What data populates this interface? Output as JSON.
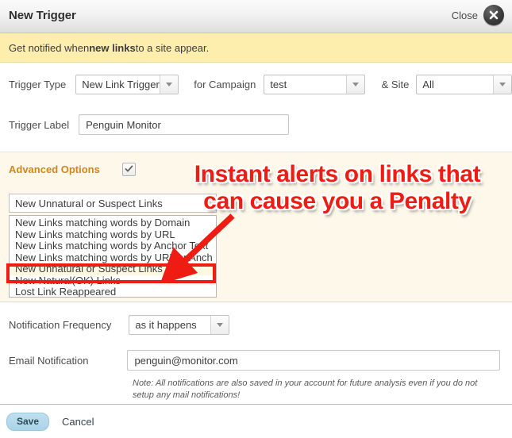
{
  "dialog": {
    "title": "New Trigger",
    "close_label": "Close",
    "close_icon": "close-circle-icon"
  },
  "notice": {
    "prefix": "Get notified when ",
    "emphasis": "new links",
    "suffix": " to a site appear."
  },
  "form": {
    "trigger_type_label": "Trigger Type",
    "trigger_type_value": "New Link Trigger",
    "for_campaign_label": "for Campaign",
    "campaign_value": "test",
    "site_label": "& Site",
    "site_value": "All",
    "trigger_label_label": "Trigger Label",
    "trigger_label_value": "Penguin Monitor",
    "trigger_label_placeholder": "Trigger Label"
  },
  "advanced": {
    "title": "Advanced Options",
    "checkbox_checked": true,
    "selected_value": "New Unnatural or Suspect Links",
    "options": [
      "New Links matching words by Domain",
      "New Links matching words by URL",
      "New Links matching words by Anchor Text",
      "New Links matching words by URL or Anch",
      "New Unnatural or Suspect Links",
      "New Natural(OK) Links",
      "Lost Link Reappeared"
    ],
    "selected_index": 4
  },
  "annotation": {
    "line1": "Instant alerts on links that",
    "line2": "can cause you a Penalty",
    "color": "#ee1c12",
    "highlight_color": "#ee1c12"
  },
  "notification": {
    "frequency_label": "Notification Frequency",
    "frequency_value": "as it happens",
    "email_label": "Email Notification",
    "email_value": "penguin@monitor.com",
    "email_placeholder": "Email Notification",
    "note": "Note: All notifications are also saved in your account for future analysis even if you do not setup any mail notifications!"
  },
  "footer": {
    "save_label": "Save",
    "cancel_label": "Cancel"
  }
}
